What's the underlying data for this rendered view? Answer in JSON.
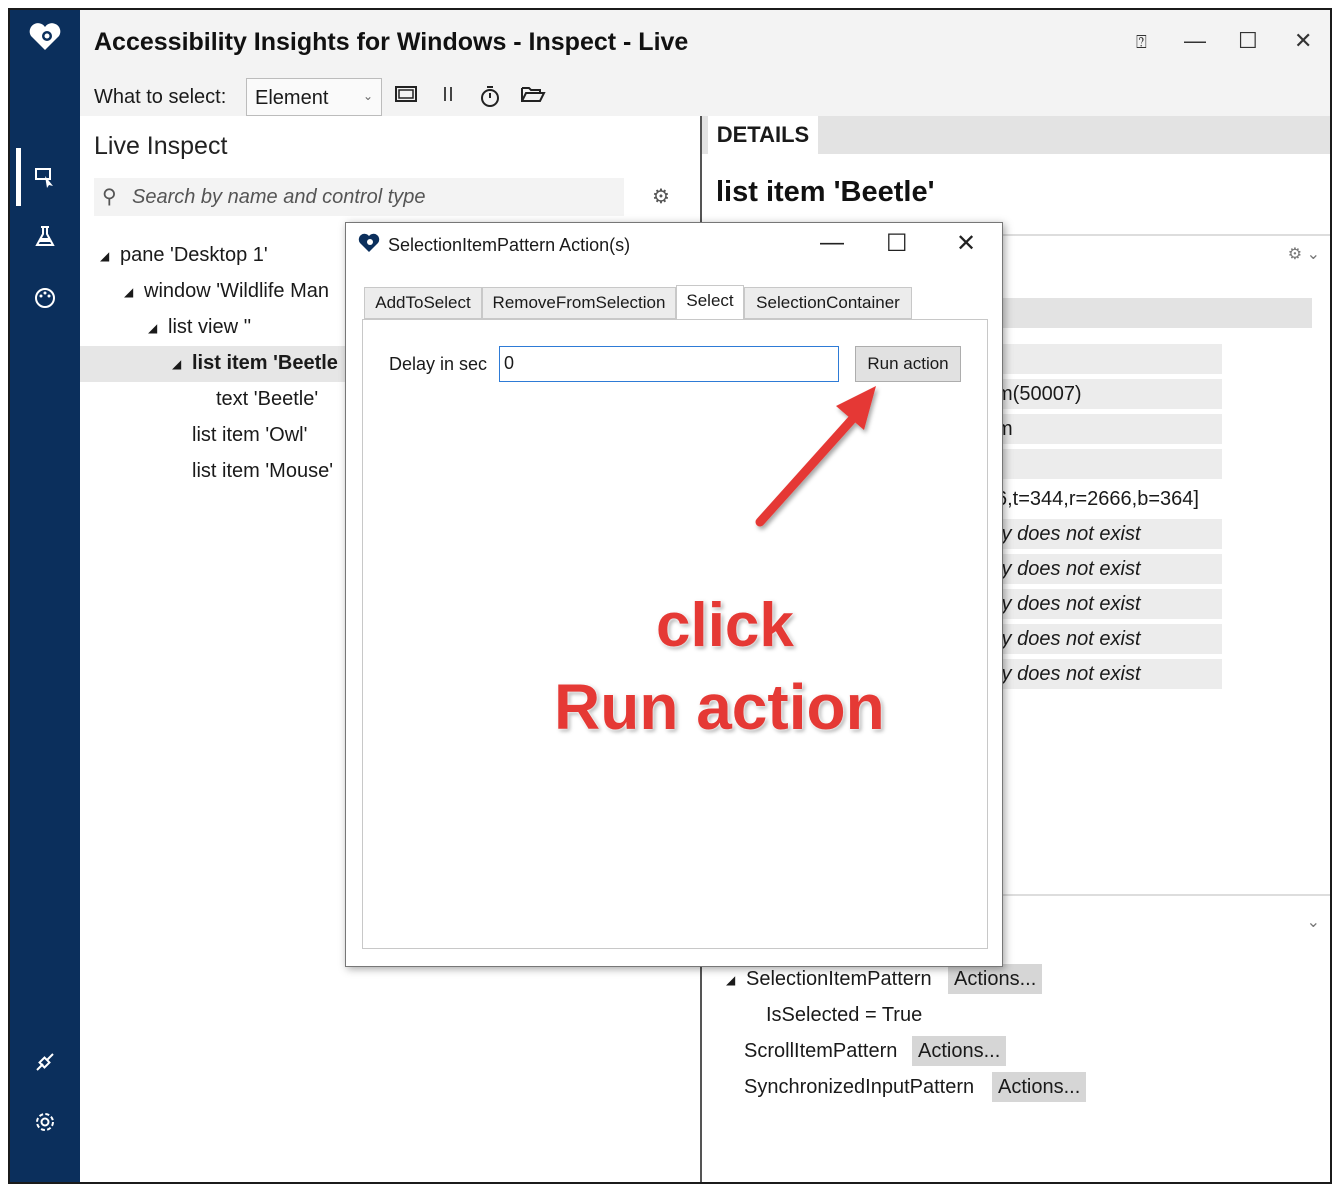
{
  "app": {
    "title": "Accessibility Insights for Windows - Inspect - Live",
    "window_controls": {
      "help": "⍰",
      "minimize": "—",
      "maximize": "☐",
      "close": "✕"
    }
  },
  "toolbar": {
    "what_to_select_label": "What to select:",
    "select_value": "Element",
    "icons": [
      "screenshot-icon",
      "pause-icon",
      "timer-icon",
      "open-folder-icon"
    ]
  },
  "rail": {
    "icons": [
      "logo-icon",
      "inspect-icon",
      "test-icon",
      "color-contrast-icon",
      "connection-icon",
      "settings-icon"
    ]
  },
  "live_inspect": {
    "title": "Live Inspect",
    "search_placeholder": "Search by name and control type",
    "tree": [
      {
        "label": "pane 'Desktop 1'",
        "expanded": true
      },
      {
        "label": "window 'Wildlife Man",
        "expanded": true
      },
      {
        "label": "list view ''",
        "expanded": true
      },
      {
        "label": "list item 'Beetle",
        "expanded": true,
        "selected": true
      },
      {
        "label": "text 'Beetle'"
      },
      {
        "label": "list item 'Owl'"
      },
      {
        "label": "list item 'Mouse'"
      }
    ]
  },
  "details": {
    "tab_label": "DETAILS",
    "element_title": "list item 'Beetle'",
    "property_values": [
      "",
      "m(50007)",
      "m",
      "",
      "6,t=344,r=2666,b=364]",
      "ty does not exist",
      "ty does not exist",
      "ty does not exist",
      "ty does not exist",
      "ty does not exist"
    ],
    "patterns": [
      {
        "name": "SelectionItemPattern",
        "action": "Actions...",
        "expanded": true
      },
      {
        "name": "IsSelected = True"
      },
      {
        "name": "ScrollItemPattern",
        "action": "Actions..."
      },
      {
        "name": "SynchronizedInputPattern",
        "action": "Actions..."
      }
    ]
  },
  "dialog": {
    "title": "SelectionItemPattern Action(s)",
    "tabs": [
      "AddToSelect",
      "RemoveFromSelection",
      "Select",
      "SelectionContainer"
    ],
    "active_tab": "Select",
    "delay_label": "Delay in sec",
    "delay_value": "0",
    "run_button": "Run action"
  },
  "annotation": {
    "line1": "click",
    "line2": "Run action",
    "color": "#e53935"
  },
  "colors": {
    "rail": "#0b2f5c",
    "accent": "#2e7bd6"
  }
}
